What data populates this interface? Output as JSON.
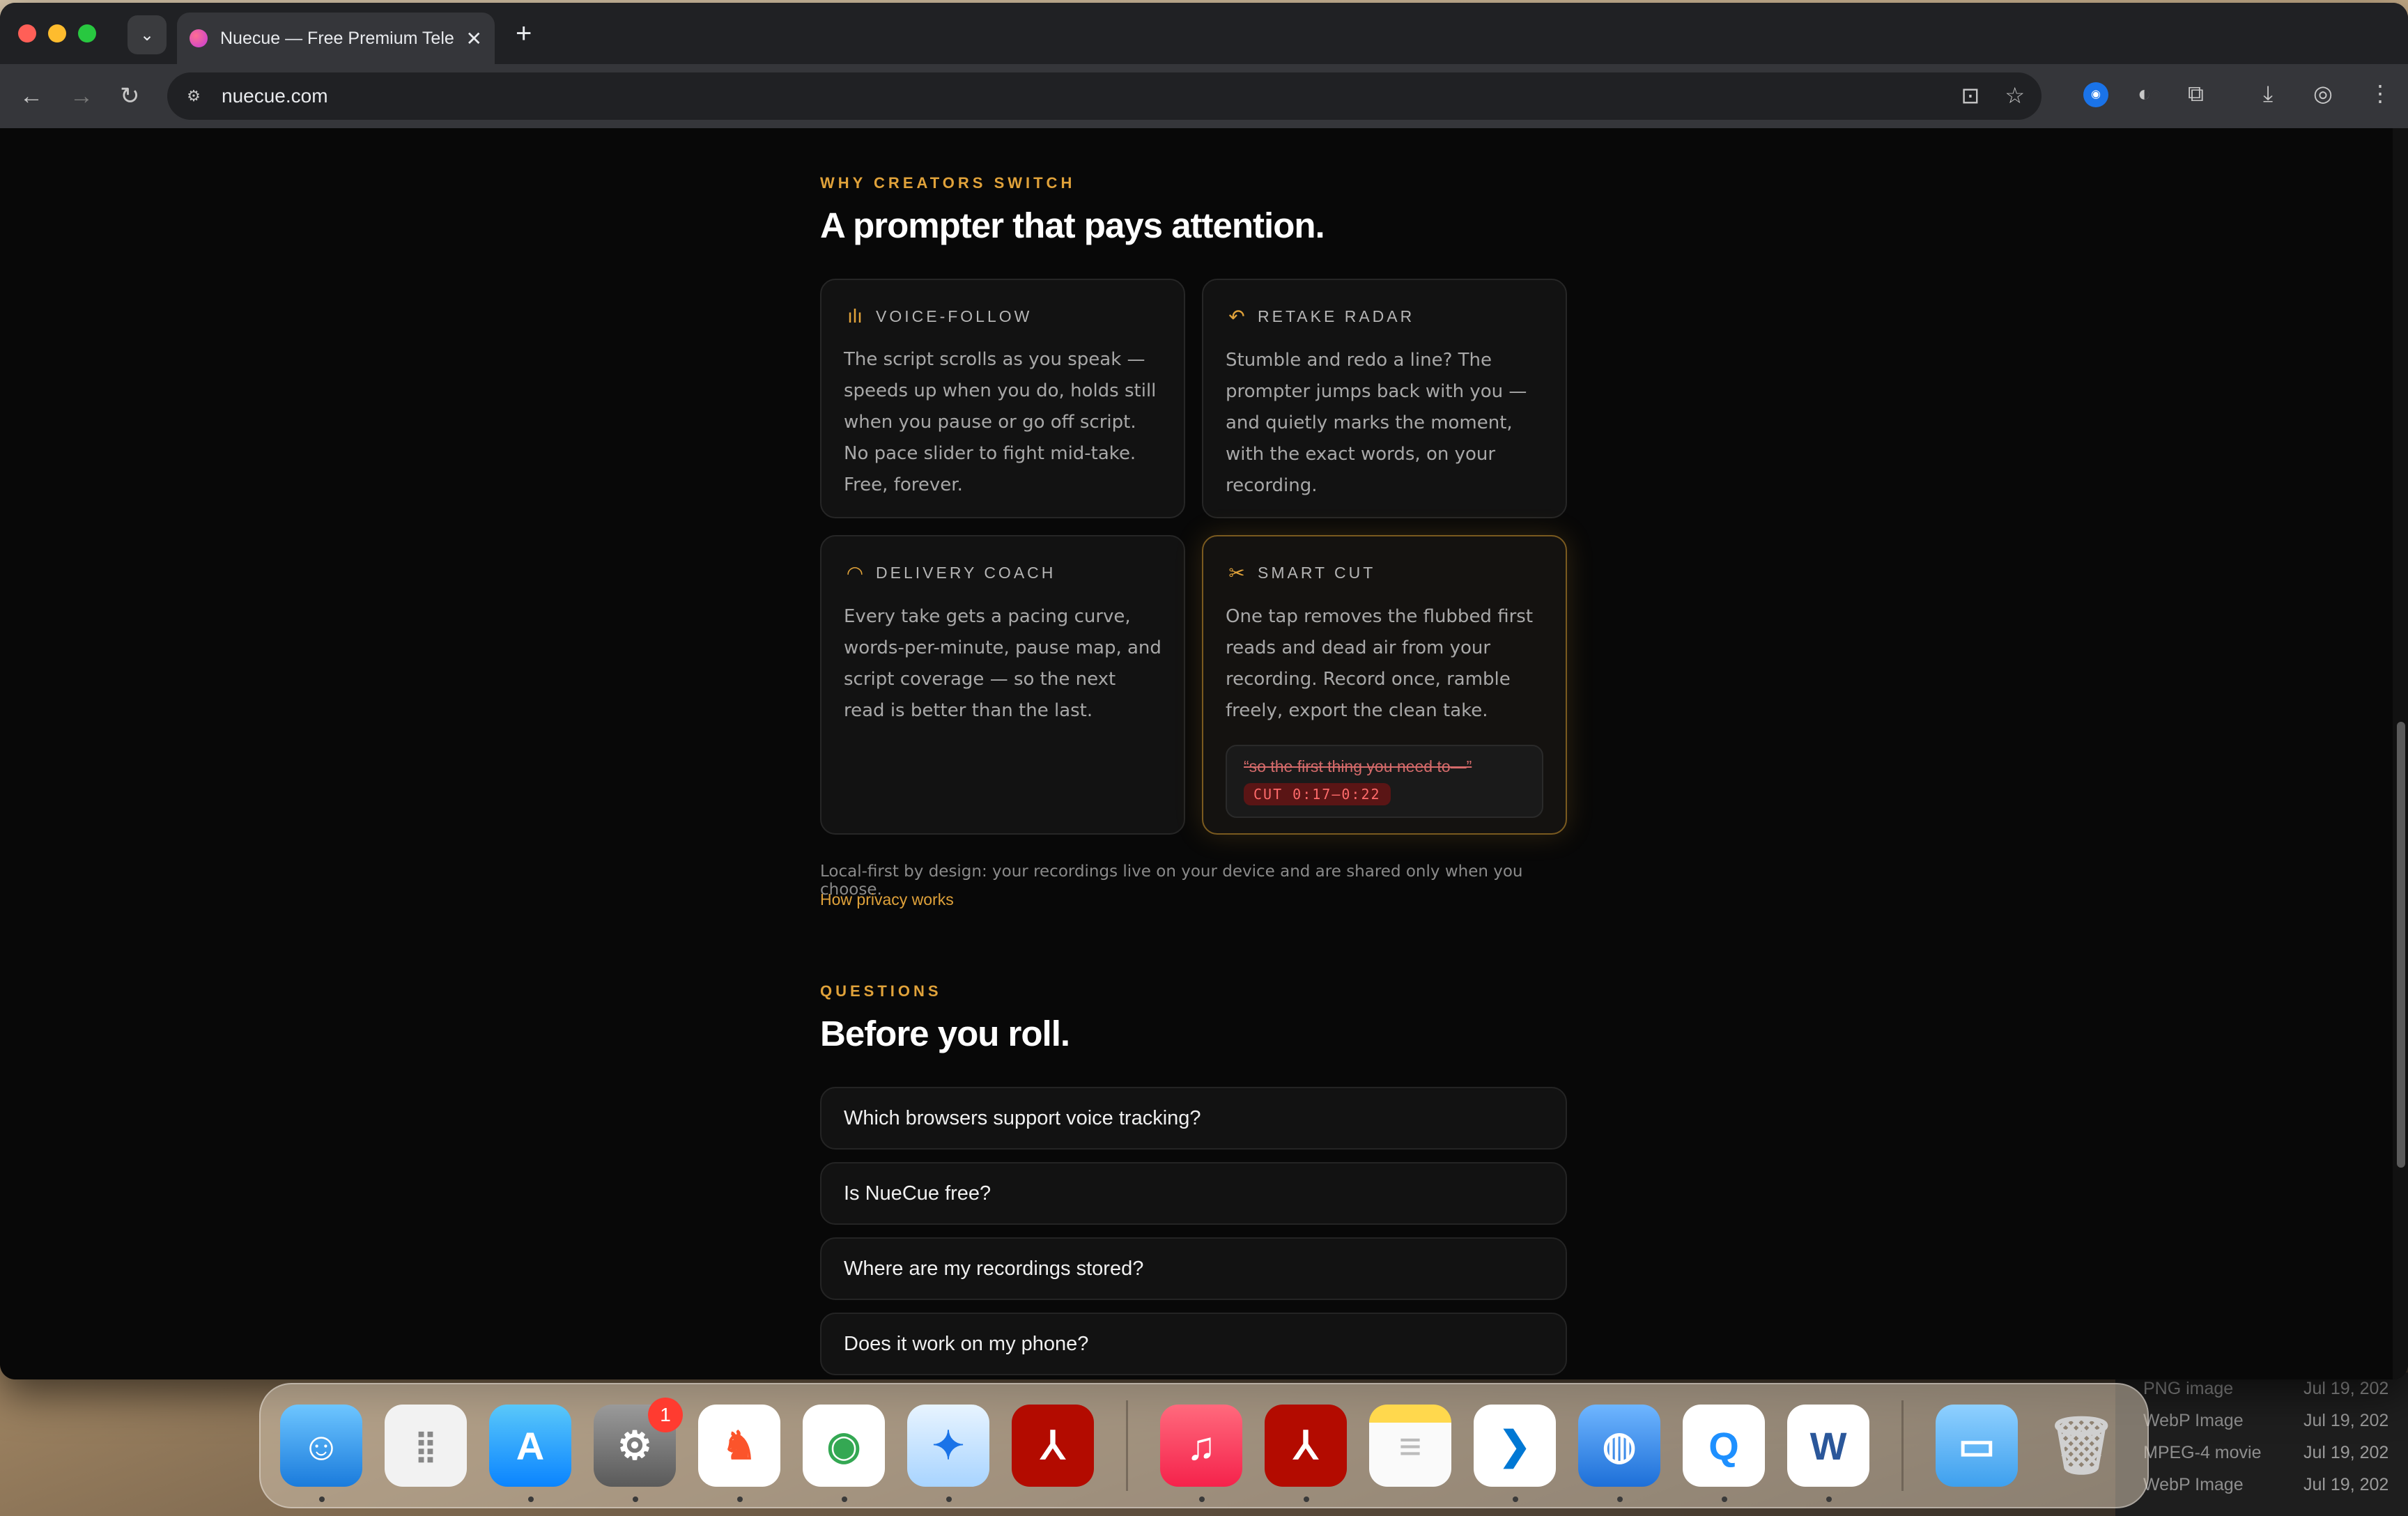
{
  "browser": {
    "tab_title": "Nuecue — Free Premium Tele",
    "url": "nuecue.com",
    "new_tab": "+",
    "tab_close": "✕"
  },
  "section_features": {
    "eyebrow": "WHY CREATORS SWITCH",
    "heading": "A prompter that pays attention.",
    "cards": [
      {
        "label": "VOICE-FOLLOW",
        "icon": "waveform-icon",
        "body": "The script scrolls as you speak — speeds up when you do, holds still when you pause or go off script. No pace slider to fight mid-take. Free, forever."
      },
      {
        "label": "RETAKE RADAR",
        "icon": "undo-arrow-icon",
        "body": "Stumble and redo a line? The prompter jumps back with you — and quietly marks the moment, with the exact words, on your recording."
      },
      {
        "label": "DELIVERY COACH",
        "icon": "gauge-icon",
        "body": "Every take gets a pacing curve, words-per-minute, pause map, and script coverage — so the next read is better than the last."
      },
      {
        "label": "SMART CUT",
        "icon": "scissors-icon",
        "body": "One tap removes the flubbed first reads and dead air from your recording. Record once, ramble freely, export the clean take."
      }
    ],
    "cut_example": {
      "quote": "“so the first thing you need to—”",
      "badge": "CUT 0:17–0:22"
    },
    "privacy_text": "Local-first by design: your recordings live on your device and are shared only when you choose.",
    "privacy_link": "How privacy works"
  },
  "section_faq": {
    "eyebrow": "QUESTIONS",
    "heading": "Before you roll.",
    "items": [
      "Which browsers support voice tracking?",
      "Is NueCue free?",
      "Where are my recordings stored?",
      "Does it work on my phone?"
    ]
  },
  "desktop_list": [
    {
      "kind": "PNG image",
      "date": "Jul 19, 202"
    },
    {
      "kind": "WebP Image",
      "date": "Jul 19, 202"
    },
    {
      "kind": "MPEG-4 movie",
      "date": "Jul 19, 202"
    },
    {
      "kind": "WebP Image",
      "date": "Jul 19, 202"
    }
  ],
  "dock": {
    "settings_badge": "1",
    "word_letter": "W"
  },
  "colors": {
    "accent": "#e0a23a",
    "page_bg": "#080808",
    "card_bg": "#121212"
  }
}
